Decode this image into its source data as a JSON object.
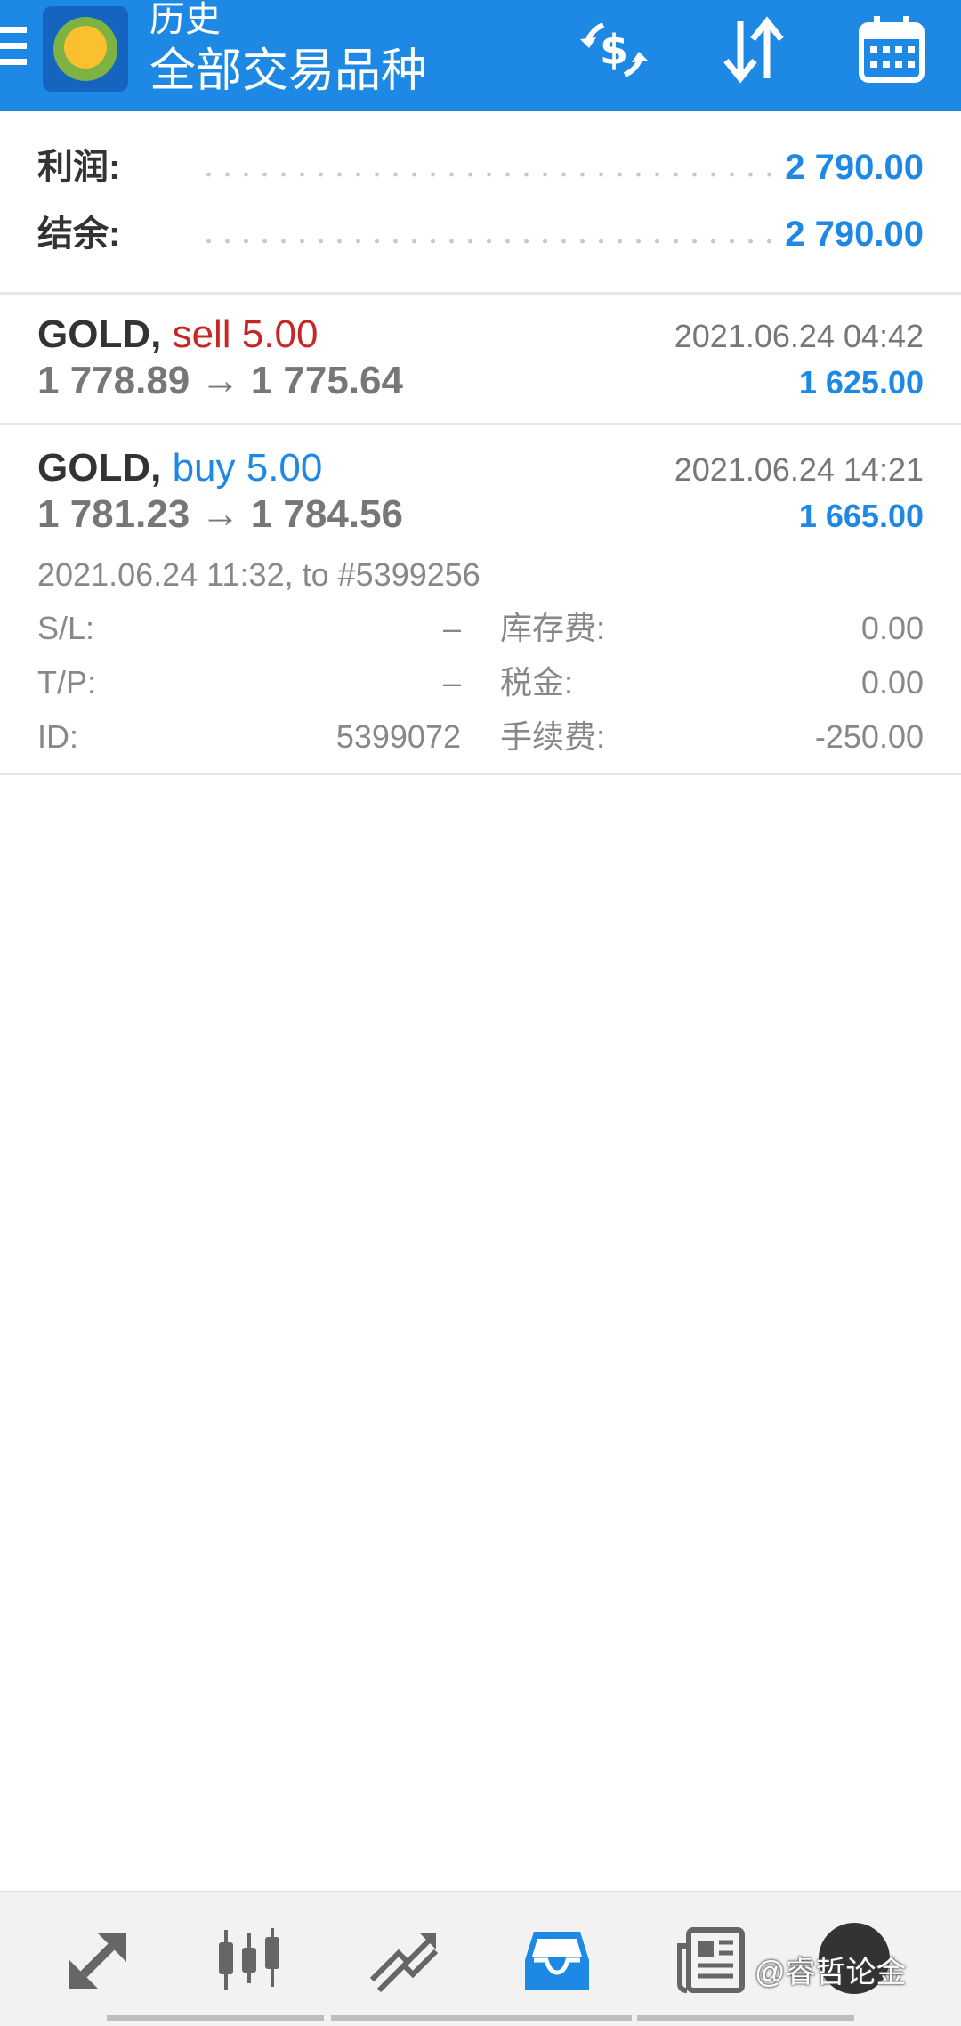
{
  "header": {
    "title": "历史",
    "subtitle": "全部交易品种",
    "icons": [
      "menu-icon",
      "app-logo",
      "currency-exchange-icon",
      "sort-icon",
      "calendar-icon"
    ]
  },
  "summary": {
    "profit_label": "利润:",
    "profit_value": "2 790.00",
    "balance_label": "结余:",
    "balance_value": "2 790.00"
  },
  "deals": [
    {
      "symbol": "GOLD,",
      "type": "sell 5.00",
      "prices": "1 778.89 → 1 775.64",
      "time": "2021.06.24 04:42",
      "profit": "1 625.00"
    },
    {
      "symbol": "GOLD,",
      "type": "buy 5.00",
      "prices": "1 781.23 → 1 784.56",
      "time": "2021.06.24 14:21",
      "profit": "1 665.00",
      "open_info": "2021.06.24 11:32, to #5399256",
      "sl_label": "S/L:",
      "sl_value": "–",
      "tp_label": "T/P:",
      "tp_value": "–",
      "id_label": "ID:",
      "id_value": "5399072",
      "swap_label": "库存费:",
      "swap_value": "0.00",
      "tax_label": "税金:",
      "tax_value": "0.00",
      "commission_label": "手续费:",
      "commission_value": "-250.00"
    }
  ],
  "bottom_nav": {
    "items": [
      "quotes-icon",
      "chart-icon",
      "trade-icon",
      "history-icon",
      "news-icon"
    ],
    "active": "history-icon"
  },
  "watermark": "@睿哲论金",
  "colors": {
    "header": "#1e88e5",
    "sell": "#c62828",
    "buy": "#1e88e5",
    "active_nav": "#1e88e5"
  }
}
